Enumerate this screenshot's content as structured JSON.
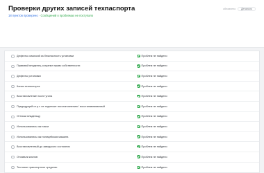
{
  "header": {
    "title": "Проверки других записей техпаспорта",
    "subtitle_count": "18 пунктов проверено",
    "subtitle_sep": " · ",
    "subtitle_status": "Сообщений о проблемах не поступало",
    "meta_label": "обновлено",
    "meta_value": "Детально"
  },
  "rows": [
    {
      "label": "Дефекты комиссий за безопасность установки",
      "status": "Проблем не найдено"
    },
    {
      "label": "Правовой владелец сохранил право собственности",
      "status": "Проблем не найдено"
    },
    {
      "label": "Дефекты установки",
      "status": "Проблем не найдено"
    },
    {
      "label": "Копия техпаспорта",
      "status": "Проблем не найдено"
    },
    {
      "label": "Восстановление после угона",
      "status": "Проблем не найдено"
    },
    {
      "label": "Предыдущий ит.р.т. не подлежит восстановлению / восстанавливаемый",
      "status": "Проблем не найдено"
    },
    {
      "label": "Оттиски владельцу",
      "status": "Проблем не найдено"
    },
    {
      "label": "Использовались как такси",
      "status": "Проблем не найдено"
    },
    {
      "label": "Использовались как полицейская машина",
      "status": "Проблем не найдено"
    },
    {
      "label": "Восстановленный до заводского состояния",
      "status": "Проблем не найдено"
    },
    {
      "label": "Отозвали кислов",
      "status": "Проблем не найдено"
    },
    {
      "label": "Тестовое транспортное средство",
      "status": "Проблем не найдено"
    }
  ]
}
